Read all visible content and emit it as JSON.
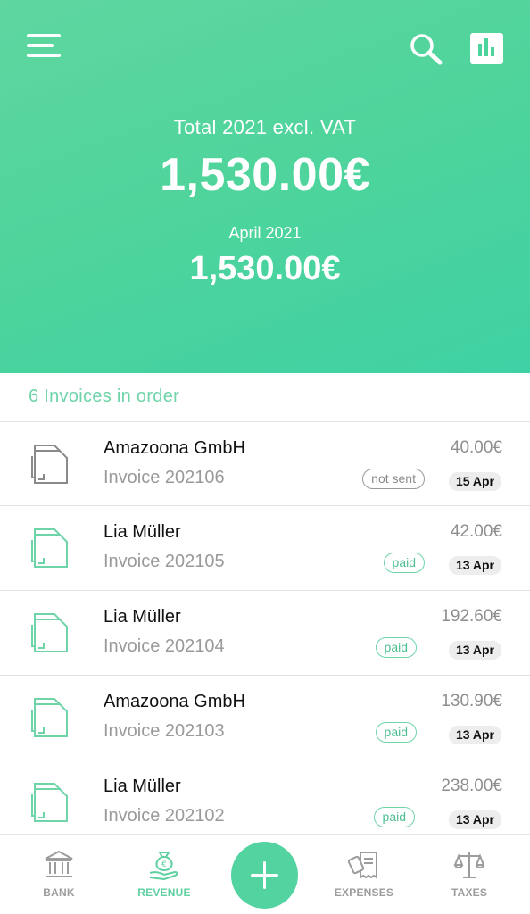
{
  "header": {
    "total_label": "Total 2021 excl. VAT",
    "total_value": "1,530.00€",
    "month_label": "April 2021",
    "month_value": "1,530.00€",
    "icons": [
      "menu-icon",
      "search-icon",
      "bar-chart-icon"
    ]
  },
  "list": {
    "heading": "6 Invoices in order",
    "invoices": [
      {
        "client": "Amazoona GmbH",
        "number": "Invoice 202106",
        "amount": "40.00€",
        "status": "not sent",
        "date": "15 Apr"
      },
      {
        "client": "Lia Müller",
        "number": "Invoice 202105",
        "amount": "42.00€",
        "status": "paid",
        "date": "13 Apr"
      },
      {
        "client": "Lia Müller",
        "number": "Invoice 202104",
        "amount": "192.60€",
        "status": "paid",
        "date": "13 Apr"
      },
      {
        "client": "Amazoona GmbH",
        "number": "Invoice 202103",
        "amount": "130.90€",
        "status": "paid",
        "date": "13 Apr"
      },
      {
        "client": "Lia Müller",
        "number": "Invoice 202102",
        "amount": "238.00€",
        "status": "paid",
        "date": "13 Apr"
      }
    ]
  },
  "nav": {
    "bank": "BANK",
    "revenue": "REVENUE",
    "expenses": "EXPENSES",
    "taxes": "TAXES",
    "active": "revenue"
  },
  "colors": {
    "accent": "#4ed49c",
    "paid": "#6fd4a8",
    "muted": "#9a9a9a"
  }
}
